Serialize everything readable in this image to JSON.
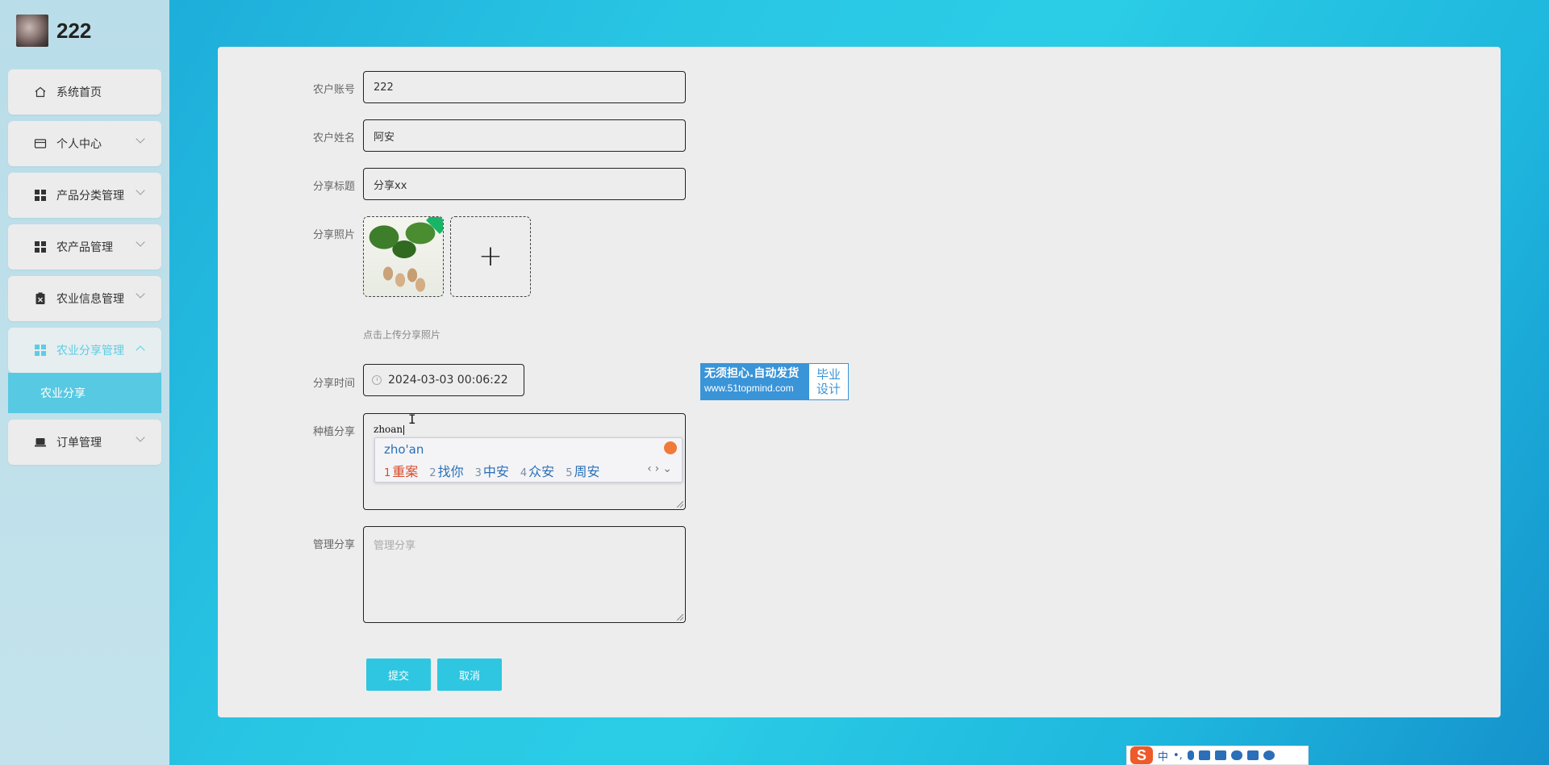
{
  "sidebar": {
    "username": "222",
    "items": [
      {
        "label": "系统首页",
        "icon": "home-icon"
      },
      {
        "label": "个人中心",
        "icon": "card-icon"
      },
      {
        "label": "产品分类管理",
        "icon": "grid-icon"
      },
      {
        "label": "农产品管理",
        "icon": "grid-icon"
      },
      {
        "label": "农业信息管理",
        "icon": "clipboard-icon"
      },
      {
        "label": "农业分享管理",
        "icon": "grid-icon"
      },
      {
        "label": "订单管理",
        "icon": "laptop-icon"
      }
    ],
    "submenu": {
      "label": "农业分享"
    }
  },
  "form": {
    "account_label": "农户账号",
    "account_value": "222",
    "name_label": "农户姓名",
    "name_value": "阿安",
    "title_label": "分享标题",
    "title_value": "分享xx",
    "photo_label": "分享照片",
    "photo_hint": "点击上传分享照片",
    "time_label": "分享时间",
    "time_value": "2024-03-03 00:06:22",
    "planting_label": "种植分享",
    "planting_typed": "zhoan",
    "manage_label": "管理分享",
    "manage_placeholder": "管理分享",
    "submit_label": "提交",
    "cancel_label": "取消"
  },
  "ime": {
    "input": "zho'an",
    "candidates": [
      {
        "n": "1",
        "text": "重案"
      },
      {
        "n": "2",
        "text": "找你"
      },
      {
        "n": "3",
        "text": "中安"
      },
      {
        "n": "4",
        "text": "众安"
      },
      {
        "n": "5",
        "text": "周安"
      }
    ]
  },
  "watermark": {
    "line1": "无须担心.自动发货",
    "line2": "www.51topmind.com",
    "right1": "毕业",
    "right2": "设计"
  },
  "taskbar_ime": {
    "logo": "S",
    "mode": "中",
    "punct": "•,"
  },
  "colors": {
    "accent": "#2ec6e0",
    "submenu_bg": "#57c9e2",
    "panel_bg": "#ededed"
  }
}
